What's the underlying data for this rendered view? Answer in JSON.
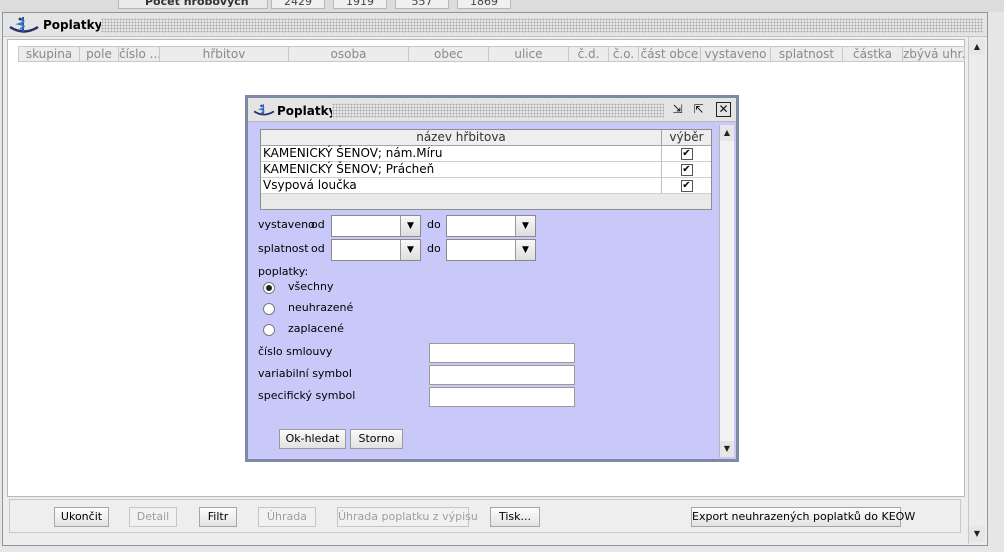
{
  "background_window": {
    "cut_label": "Počet hrobových míst",
    "cut_values": [
      "2429",
      "1919",
      "557",
      "1869"
    ]
  },
  "main_window": {
    "title": "Poplatky",
    "columns": [
      "skupina",
      "pole",
      "číslo ...",
      "hřbitov",
      "osoba",
      "obec",
      "ulice",
      "č.d.",
      "č.o.",
      "část obce",
      "vystaveno",
      "splatnost",
      "částka",
      "zbývá uhr..."
    ],
    "buttons": {
      "close": "Ukončit",
      "detail": "Detail",
      "filter": "Filtr",
      "payment": "Úhrada",
      "payment_from_statement": "Úhrada poplatku z výpisu",
      "print": "Tisk...",
      "export": "Export neuhrazených poplatků do KEOW"
    }
  },
  "dialog": {
    "title": "Poplatky",
    "table": {
      "col_name": "název hřbitova",
      "col_select": "výběr",
      "rows": [
        {
          "name": "KAMENICKÝ ŠENOV;  nám.Míru",
          "checked": "✔"
        },
        {
          "name": "KAMENICKÝ ŠENOV;  Prácheň",
          "checked": "✔"
        },
        {
          "name": "Vsypová loučka",
          "checked": "✔"
        }
      ]
    },
    "issued_label": "vystaveno",
    "due_label": "splatnost",
    "from_label": "od",
    "to_label": "do",
    "issued_from": "",
    "issued_to": "",
    "due_from": "",
    "due_to": "",
    "fees_label": "poplatky:",
    "radio_all": "všechny",
    "radio_unpaid": "neuhrazené",
    "radio_paid": "zaplacené",
    "selected_radio": "všechny",
    "contract_label": "číslo smlouvy",
    "variable_label": "variabilní symbol",
    "specific_label": "specifický symbol",
    "contract_value": "",
    "variable_value": "",
    "specific_value": "",
    "ok_button": "Ok-hledat",
    "cancel_button": "Storno"
  },
  "icons": {
    "app_logo": "snake-bowl-icon",
    "minimize": "minimize-icon",
    "maximize": "maximize-icon",
    "close": "close-icon",
    "dropdown": "chevron-down-icon",
    "scroll_up": "arrow-up-icon",
    "scroll_down": "arrow-down-icon"
  },
  "colors": {
    "dialog_bg": "#c9c9f9",
    "window_border": "#7c8aa6",
    "disabled_text": "#9e9e9e"
  }
}
